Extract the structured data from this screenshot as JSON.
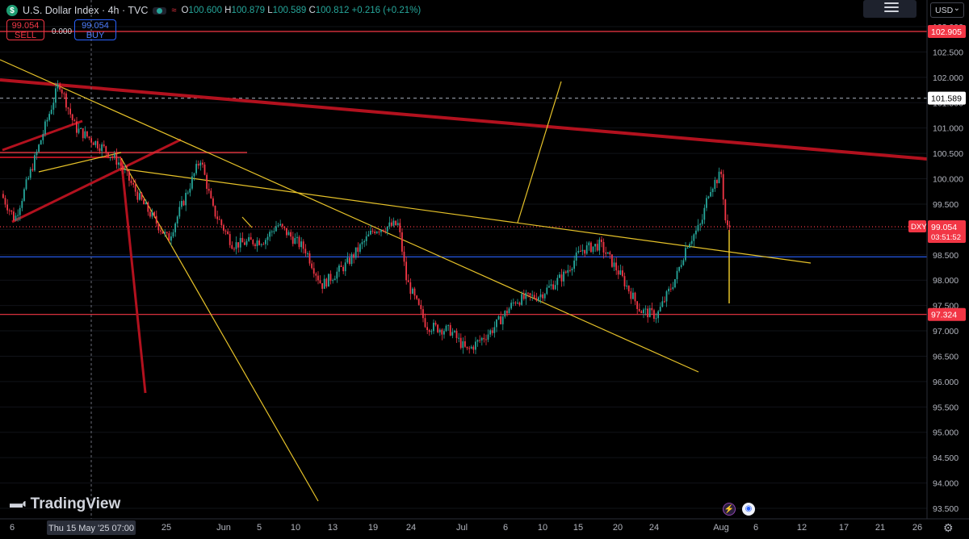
{
  "header": {
    "symbol_icon": "$",
    "title": "U.S. Dollar Index · 4h · TVC",
    "wave_icon": "≈",
    "ohlc": {
      "o_label": "O",
      "o": "100.600",
      "h_label": "H",
      "h": "100.879",
      "l_label": "L",
      "l": "100.589",
      "c_label": "C",
      "c": "100.812",
      "change": "+0.216 (+0.21%)"
    }
  },
  "trade": {
    "sell_price": "99.054",
    "sell_label": "SELL",
    "spread": "0.000",
    "buy_price": "99.054",
    "buy_label": "BUY"
  },
  "currency": "USD",
  "logo_text": "TradingView",
  "event_icons": [
    "lightning-icon",
    "flag-icon"
  ],
  "price_axis": {
    "ticks": [
      "103.000",
      "102.500",
      "102.000",
      "101.500",
      "101.000",
      "100.500",
      "100.000",
      "99.500",
      "99.000",
      "98.500",
      "98.000",
      "97.500",
      "97.000",
      "96.500",
      "96.000",
      "95.500",
      "95.000",
      "94.500",
      "94.000",
      "93.500"
    ],
    "labels": [
      {
        "text": "102.905",
        "value": 102.905,
        "color": "#f23645"
      },
      {
        "text": "101.589",
        "value": 101.589,
        "color": "#ffffff"
      },
      {
        "text": "97.324",
        "value": 97.324,
        "color": "#f23645"
      }
    ],
    "current": {
      "symbol": "DXY",
      "price": "99.054",
      "countdown": "03:51:52",
      "value": 99.054,
      "color": "#f23645"
    }
  },
  "time_axis": {
    "ticks": [
      "6",
      "Thu 15 May '25",
      "07:00",
      "25",
      "Jun",
      "5",
      "10",
      "13",
      "19",
      "24",
      "Jul",
      "6",
      "10",
      "15",
      "20",
      "24",
      "Aug",
      "6",
      "12",
      "17",
      "21",
      "26"
    ],
    "cursor_label": "Thu 15 May '25   07:00"
  },
  "horizontal_lines": [
    {
      "value": 102.905,
      "color": "#f23645"
    },
    {
      "value": 101.589,
      "color": "#9aa0ac",
      "dashed": true
    },
    {
      "value": 98.46,
      "color": "#2962ff"
    },
    {
      "value": 97.324,
      "color": "#f23645"
    },
    {
      "value": 99.054,
      "color": "#f23645",
      "dotted": true
    }
  ],
  "colors": {
    "up": "#26a69a",
    "down": "#f23645",
    "trend_red": "#b2111e",
    "trend_yellow": "#e6c229"
  }
}
